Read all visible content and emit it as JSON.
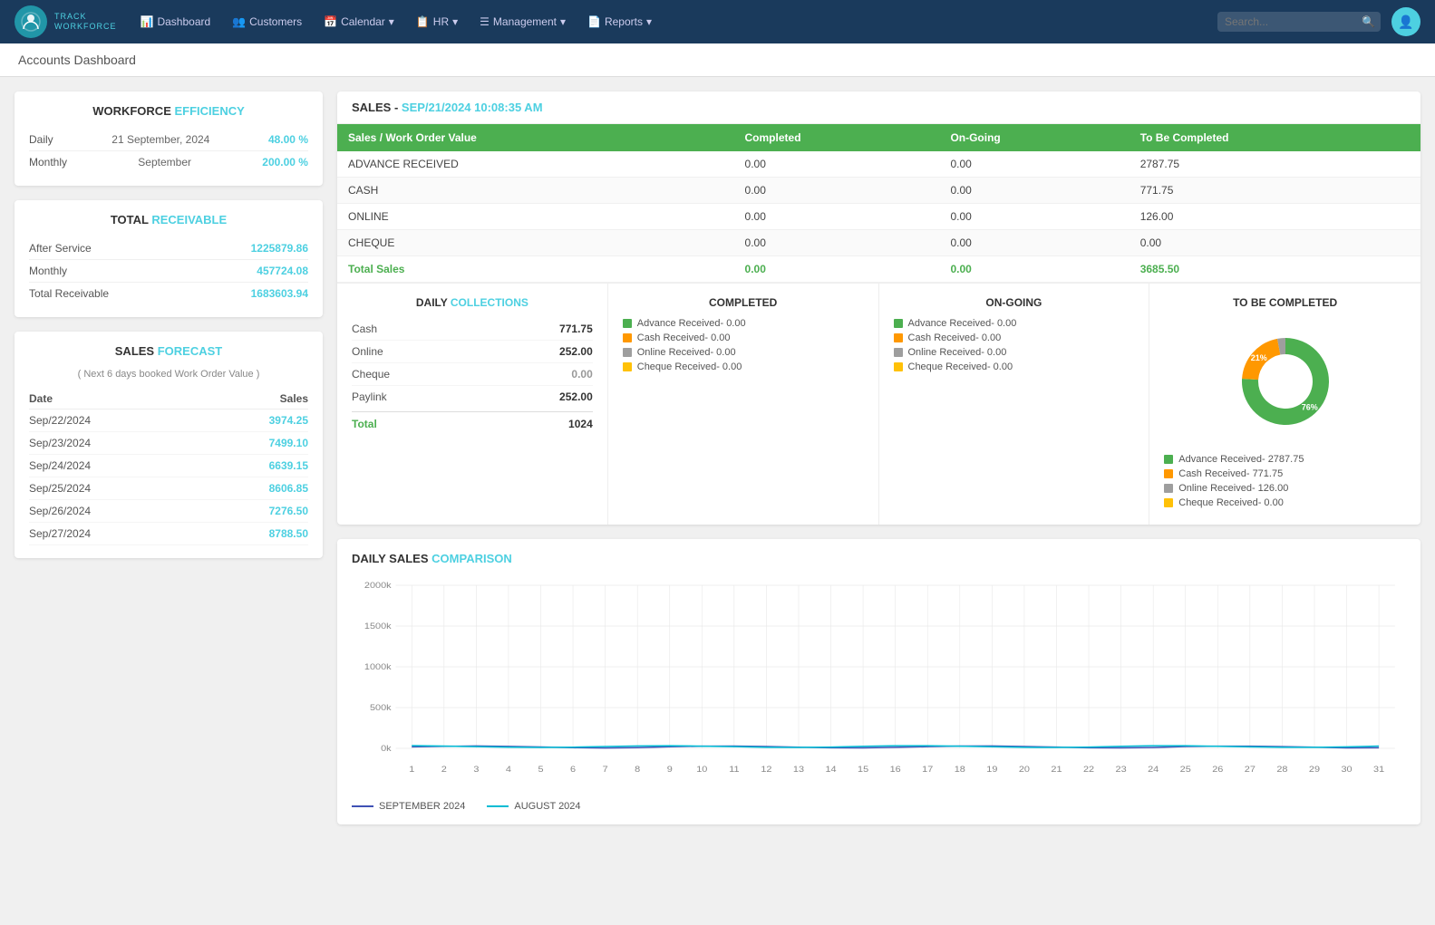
{
  "nav": {
    "brand_name": "TRACK",
    "brand_sub": "WORKFORCE",
    "items": [
      {
        "label": "Dashboard",
        "icon": "📊",
        "href": "#"
      },
      {
        "label": "Customers",
        "icon": "👥",
        "href": "#"
      },
      {
        "label": "Calendar",
        "icon": "📅",
        "href": "#",
        "dropdown": true
      },
      {
        "label": "HR",
        "icon": "📋",
        "href": "#",
        "dropdown": true
      },
      {
        "label": "Management",
        "icon": "☰",
        "href": "#",
        "dropdown": true
      },
      {
        "label": "Reports",
        "icon": "📄",
        "href": "#",
        "dropdown": true
      }
    ],
    "search_placeholder": "Search..."
  },
  "page": {
    "title": "Accounts Dashboard"
  },
  "workforce": {
    "title_plain": "WORKFORCE",
    "title_highlight": "EFFICIENCY",
    "daily_label": "Daily",
    "daily_date": "21 September, 2024",
    "daily_value": "48.00 %",
    "monthly_label": "Monthly",
    "monthly_period": "September",
    "monthly_value": "200.00 %"
  },
  "receivable": {
    "title_plain": "TOTAL",
    "title_highlight": "RECEIVABLE",
    "after_service_label": "After Service",
    "after_service_value": "1225879.86",
    "monthly_label": "Monthly",
    "monthly_value": "457724.08",
    "total_label": "Total Receivable",
    "total_value": "1683603.94"
  },
  "forecast": {
    "title_plain": "SALES",
    "title_highlight": "FORECAST",
    "note": "( Next 6 days booked Work Order Value )",
    "date_col": "Date",
    "sales_col": "Sales",
    "rows": [
      {
        "date": "Sep/22/2024",
        "sales": "3974.25"
      },
      {
        "date": "Sep/23/2024",
        "sales": "7499.10"
      },
      {
        "date": "Sep/24/2024",
        "sales": "6639.15"
      },
      {
        "date": "Sep/25/2024",
        "sales": "8606.85"
      },
      {
        "date": "Sep/26/2024",
        "sales": "7276.50"
      },
      {
        "date": "Sep/27/2024",
        "sales": "8788.50"
      }
    ]
  },
  "sales": {
    "title": "SALES",
    "timestamp": "SEP/21/2024 10:08:35 AM",
    "columns": [
      "Sales / Work Order Value",
      "Completed",
      "On-Going",
      "To Be Completed"
    ],
    "rows": [
      {
        "label": "ADVANCE RECEIVED",
        "completed": "0.00",
        "ongoing": "0.00",
        "tobe": "2787.75"
      },
      {
        "label": "CASH",
        "completed": "0.00",
        "ongoing": "0.00",
        "tobe": "771.75"
      },
      {
        "label": "ONLINE",
        "completed": "0.00",
        "ongoing": "0.00",
        "tobe": "126.00"
      },
      {
        "label": "CHEQUE",
        "completed": "0.00",
        "ongoing": "0.00",
        "tobe": "0.00"
      },
      {
        "label": "Total Sales",
        "completed": "0.00",
        "ongoing": "0.00",
        "tobe": "3685.50",
        "is_total": true
      }
    ]
  },
  "daily_collections": {
    "title_plain": "DAILY",
    "title_highlight": "COLLECTIONS",
    "rows": [
      {
        "label": "Cash",
        "value": "771.75"
      },
      {
        "label": "Online",
        "value": "252.00"
      },
      {
        "label": "Cheque",
        "value": "0.00"
      },
      {
        "label": "Paylink",
        "value": "252.00"
      }
    ],
    "total_label": "Total",
    "total_value": "1024"
  },
  "completed": {
    "title": "COMPLETED",
    "legend": [
      {
        "color": "#4caf50",
        "label": "Advance Received-  0.00"
      },
      {
        "color": "#ff9800",
        "label": "Cash Received-  0.00"
      },
      {
        "color": "#9e9e9e",
        "label": "Online Received-  0.00"
      },
      {
        "color": "#ffc107",
        "label": "Cheque Received-  0.00"
      }
    ]
  },
  "ongoing": {
    "title": "ON-GOING",
    "legend": [
      {
        "color": "#4caf50",
        "label": "Advance Received-  0.00"
      },
      {
        "color": "#ff9800",
        "label": "Cash Received-  0.00"
      },
      {
        "color": "#9e9e9e",
        "label": "Online Received-  0.00"
      },
      {
        "color": "#ffc107",
        "label": "Cheque Received-  0.00"
      }
    ]
  },
  "tobe": {
    "title": "TO BE COMPLETED",
    "donut": {
      "segments": [
        {
          "color": "#4caf50",
          "pct": 76,
          "label": "76%"
        },
        {
          "color": "#ff9800",
          "pct": 21,
          "label": "21%"
        },
        {
          "color": "#9e9e9e",
          "pct": 3,
          "label": "3%"
        },
        {
          "color": "#ffc107",
          "pct": 0,
          "label": "0%"
        }
      ]
    },
    "legend": [
      {
        "color": "#4caf50",
        "label": "Advance Received-  2787.75"
      },
      {
        "color": "#ff9800",
        "label": "Cash Received-  771.75"
      },
      {
        "color": "#9e9e9e",
        "label": "Online Received-  126.00"
      },
      {
        "color": "#ffc107",
        "label": "Cheque Received-  0.00"
      }
    ]
  },
  "comparison": {
    "title_plain": "DAILY SALES",
    "title_highlight": "COMPARISON",
    "x_labels": [
      "1",
      "2",
      "3",
      "4",
      "5",
      "6",
      "7",
      "8",
      "9",
      "10",
      "11",
      "12",
      "13",
      "14",
      "15",
      "16",
      "17",
      "18",
      "19",
      "20",
      "21",
      "22",
      "23",
      "24",
      "25",
      "26",
      "27",
      "28",
      "29",
      "30",
      "31"
    ],
    "y_labels": [
      "2000k",
      "1500k",
      "1000k",
      "500k",
      "0k"
    ],
    "legend": [
      {
        "color": "#3f51b5",
        "label": "SEPTEMBER 2024"
      },
      {
        "color": "#00bcd4",
        "label": "AUGUST 2024"
      }
    ]
  }
}
